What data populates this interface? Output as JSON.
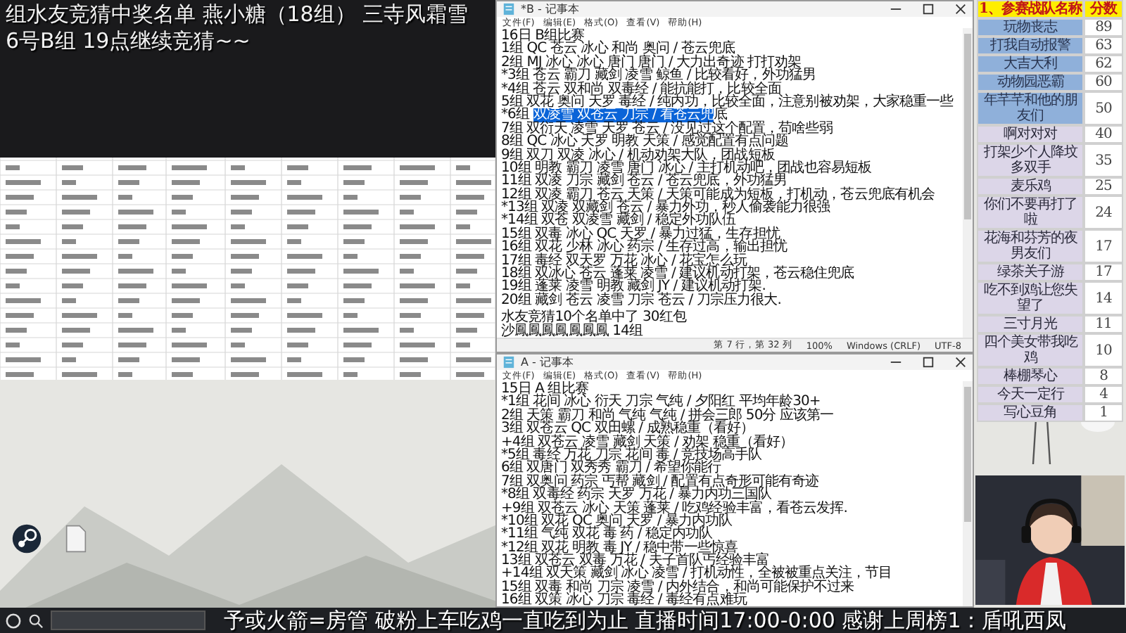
{
  "stream_overlay": {
    "lines": [
      "组水友竞猜中奖名单 燕小糖（18组） 三寺风霜雪",
      "6号B组 19点继续竞猜~~"
    ]
  },
  "notepads": [
    {
      "title": "*B - 记事本",
      "menu": [
        "文件(F)",
        "编辑(E)",
        "格式(O)",
        "查看(V)",
        "帮助(H)"
      ],
      "lines": [
        {
          "text": "16日 B组比赛"
        },
        {
          "text": "1组 QC 苍云 冰心 和尚 奥问 / 苍云兜底"
        },
        {
          "text": "2组 MJ 冰心 冰心 唐门 唐门 / 大力出奇迹 打打劝架"
        },
        {
          "text": "*3组 苍云 霸刀 藏剑 凌雪 鲸鱼 / 比较看好，外功猛男"
        },
        {
          "text": "*4组 苍云 双和尚 双毒经 / 能抗能打，比较全面"
        },
        {
          "text": "5组 双花 奥问 天罗 毒经 / 纯内功，比较全面，注意别被劝架，大家稳重一些"
        },
        {
          "before": "*6组 ",
          "selected": "双凌雪 双苍云 刀宗 / 看苍云兜",
          "after": "底"
        },
        {
          "text": "7组 双衍天 凌雪 天罗 苍云 / 没见过这个配置，苟啥些弱"
        },
        {
          "text": "8组 QC 冰心 天罗 明教 天策 / 感觉配置有点问题"
        },
        {
          "text": "9组 双刀 双凌 冰心 / 机动劝架大队，团战短板"
        },
        {
          "text": "10组 明教 霸刀 凌雪 唐门 冰心 / 主打机动吧，团战也容易短板"
        },
        {
          "text": "11组 双凌 刀宗 藏剑 苍云 / 苍云兜底，外功猛男"
        },
        {
          "text": "12组 双凌 霸刀 苍云 天策 / 天策可能成为短板，打机动，苍云兜底有机会"
        },
        {
          "text": "*13组 双凌 双藏剑 苍云 / 暴力外功，秒人偷袭能力很强"
        },
        {
          "text": "*14组 双苍 双凌雪 藏剑 / 稳定外功队伍"
        },
        {
          "text": "15组 双毒 冰心 QC 天罗 / 暴力过猛，生存担忧"
        },
        {
          "text": "16组 双花 少林 冰心 药宗 / 生存过高，输出担忧"
        },
        {
          "text": "17组 毒经 双天罗 万花 冰心 / 花宝怎么玩"
        },
        {
          "text": "18组 双冰心 苍云 蓬莱 凌雪 / 建议机动打架，苍云稳住兜底"
        },
        {
          "text": "19组 蓬莱 凌雪 明教 藏剑 JY / 建议机动打架."
        },
        {
          "text": "20组 藏剑 苍云 凌雪 刀宗 苍云 / 刀宗压力很大."
        },
        {
          "text": "水友竞猜10个名单中了 30红包",
          "gap_before": true
        },
        {
          "text": "沙鳳鳳鳳鳳鳳鳳鳳 14组"
        }
      ],
      "status": [
        "第 7 行，第 32 列",
        "100%",
        "Windows (CRLF)",
        "UTF-8"
      ]
    },
    {
      "title": "A - 记事本",
      "menu": [
        "文件(F)",
        "编辑(E)",
        "格式(O)",
        "查看(V)",
        "帮助(H)"
      ],
      "lines": [
        {
          "text": "15日 A 组比赛"
        },
        {
          "text": "*1组 花间 冰心 衍天 刀宗 气纯 / 夕阳红 平均年龄30+"
        },
        {
          "text": "2组 天策 霸刀 和尚 气纯 气纯 / 拼会三郎 50分 应该第一"
        },
        {
          "text": "3组 双苍云 QC 双田螺 / 成熟稳重（看好）"
        },
        {
          "text": "+4组 双苍云 凌雪 藏剑 天策 / 劝架 稳重（看好）"
        },
        {
          "text": "*5组 毒经 万花 刀宗 花间 毒 / 竞技场高手队"
        },
        {
          "text": "6组 双唐门 双秀秀 霸刀 / 希望你能行"
        },
        {
          "text": "7组 双奥问 药宗 丐帮 藏剑 / 配置有点奇形可能有奇迹"
        },
        {
          "text": "*8组 双毒经 药宗 天罗 万花 / 暴力内功三国队"
        },
        {
          "text": "+9组 双苍云 冰心 天策 蓬莱 / 吃鸡经验丰富，看苍云发挥."
        },
        {
          "text": "*10组 双花 QC 奥问 天罗 / 暴力内功队"
        },
        {
          "text": "*11组 气纯 双花 毒 药 / 稳定内功队"
        },
        {
          "text": "*12组 双花 明教 毒 JY / 稳中带一些惊喜"
        },
        {
          "text": "13组 双苍云 双毒 万花 / 夫子首队丐经验丰富"
        },
        {
          "text": "+14组 双天策 藏剑 冰心 凌雪 / 打机动性，全被被重点关注，节目"
        },
        {
          "text": "15组 双毒 和尚 刀宗 凌雪 / 内外结合，和尚可能保护不过来"
        },
        {
          "text": "16组 双策 冰心 刀宗 毒经 / 毒经有点难玩"
        }
      ]
    }
  ],
  "leaderboard": {
    "columns": [
      "1、参赛战队名称",
      "分数"
    ],
    "rows": [
      {
        "name": "玩物丧志",
        "score": "89",
        "highlighted": true
      },
      {
        "name": "打我自动报警",
        "score": "63",
        "highlighted": true
      },
      {
        "name": "大吉大利",
        "score": "62",
        "highlighted": true
      },
      {
        "name": "动物园恶霸",
        "score": "60",
        "highlighted": true
      },
      {
        "name": "年芊芊和他的朋友们",
        "score": "50",
        "highlighted": true
      },
      {
        "name": "啊对对对",
        "score": "40",
        "highlighted": false
      },
      {
        "name": "打架少个人降坟多双手",
        "score": "35",
        "highlighted": false
      },
      {
        "name": "麦乐鸡",
        "score": "25",
        "highlighted": false
      },
      {
        "name": "你们不要再打了啦",
        "score": "24",
        "highlighted": false
      },
      {
        "name": "花海和芬芳的夜男友们",
        "score": "17",
        "highlighted": false
      },
      {
        "name": "绿茶关子游",
        "score": "17",
        "highlighted": false
      },
      {
        "name": "吃不到鸡让您失望了",
        "score": "14",
        "highlighted": false
      },
      {
        "name": "三寸月光",
        "score": "11",
        "highlighted": false
      },
      {
        "name": "四个美女带我吃鸡",
        "score": "10",
        "highlighted": false
      },
      {
        "name": "棒棚琴心",
        "score": "8",
        "highlighted": false
      },
      {
        "name": "今天一定行",
        "score": "4",
        "highlighted": false
      },
      {
        "name": "写心豆角",
        "score": "1",
        "highlighted": false
      }
    ]
  },
  "ticker": "予或火箭=房管 破粉上车吃鸡一直吃到为止 直播时间17:00-0:00 感谢上周榜1：盾吼西凤"
}
